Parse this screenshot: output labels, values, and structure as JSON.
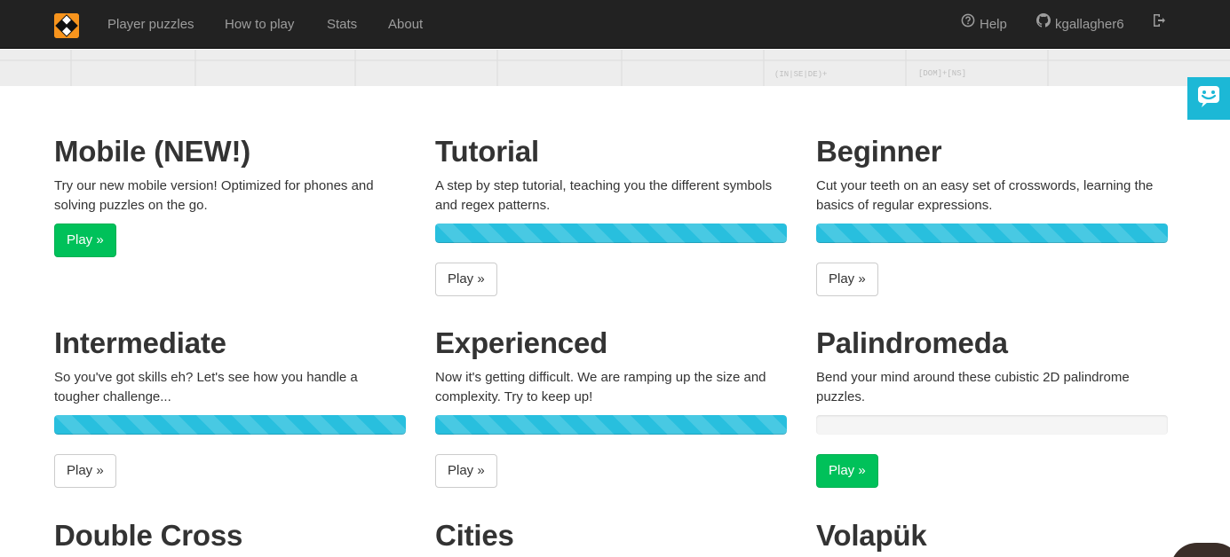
{
  "navbar": {
    "logo_icon": "diamond-grid-logo-icon",
    "links": [
      "Player puzzles",
      "How to play",
      "Stats",
      "About"
    ],
    "help_label": "Help",
    "help_icon": "question-circle-icon",
    "user_label": "kgallagher6",
    "user_icon": "github-icon",
    "logout_icon": "sign-out-icon"
  },
  "banner": {
    "texts": [
      "(IN|SE|DE)+",
      "[DOM]+[NS]"
    ]
  },
  "feedback": {
    "icon": "smiley-chat-icon"
  },
  "puzzle_sets": [
    {
      "title": "Mobile (NEW!)",
      "description": "Try our new mobile version! Optimized for phones and solving puzzles on the go.",
      "progress": null,
      "button_label": "Play »",
      "button_style": "success"
    },
    {
      "title": "Tutorial",
      "description": "A step by step tutorial, teaching you the different symbols and regex patterns.",
      "progress": 1.0,
      "button_label": "Play »",
      "button_style": "default"
    },
    {
      "title": "Beginner",
      "description": "Cut your teeth on an easy set of crosswords, learning the basics of regular expressions.",
      "progress": 1.0,
      "button_label": "Play »",
      "button_style": "default"
    },
    {
      "title": "Intermediate",
      "description": "So you've got skills eh? Let's see how you handle a tougher challenge...",
      "progress": 1.0,
      "button_label": "Play »",
      "button_style": "default"
    },
    {
      "title": "Experienced",
      "description": "Now it's getting difficult. We are ramping up the size and complexity. Try to keep up!",
      "progress": 1.0,
      "button_label": "Play »",
      "button_style": "default"
    },
    {
      "title": "Palindromeda",
      "description": "Bend your mind around these cubistic 2D palindrome puzzles.",
      "progress": 0.0,
      "button_label": "Play »",
      "button_style": "success"
    },
    {
      "title": "Double Cross",
      "description": "",
      "progress": null,
      "button_label": "",
      "button_style": "default"
    },
    {
      "title": "Cities",
      "description": "",
      "progress": null,
      "button_label": "",
      "button_style": "default"
    },
    {
      "title": "Volapük",
      "description": "",
      "progress": null,
      "button_label": "",
      "button_style": "default"
    }
  ],
  "colors": {
    "navbar_bg": "#222222",
    "nav_text": "#9d9d9d",
    "logo": "#f7941d",
    "progress": "#28bfde",
    "success": "#00c15a",
    "feedback": "#1cb8d6"
  }
}
